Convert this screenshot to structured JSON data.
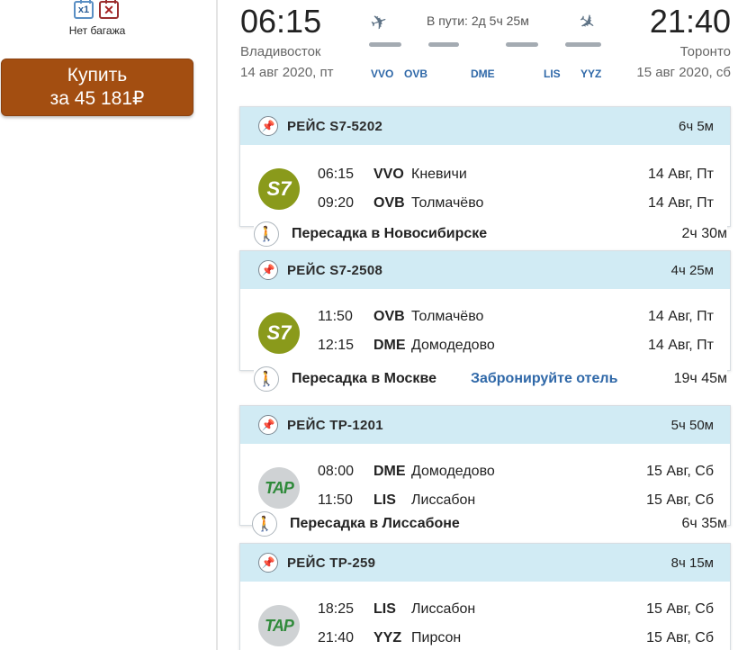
{
  "baggage": {
    "cabin_label": "x1",
    "no_bag_mark": "✕",
    "label": "Нет багажа"
  },
  "buy_button": {
    "line1": "Купить",
    "line2": "за 45 181₽"
  },
  "summary": {
    "departure_time": "06:15",
    "arrival_time": "21:40",
    "departure_city": "Владивосток",
    "arrival_city": "Торонто",
    "departure_date": "14 авг 2020, пт",
    "arrival_date": "15 авг 2020, сб",
    "travel_time": "В пути: 2д 5ч 25м",
    "codes": [
      "VVO",
      "OVB",
      "DME",
      "LIS",
      "YYZ"
    ]
  },
  "flights": [
    {
      "number": "РЕЙС S7-5202",
      "duration": "6ч 5м",
      "airline": "S7",
      "dep": {
        "time": "06:15",
        "code": "VVO",
        "name": "Кневичи",
        "date": "14 Авг, Пт"
      },
      "arr": {
        "time": "09:20",
        "code": "OVB",
        "name": "Толмачёво",
        "date": "14 Авг, Пт"
      }
    },
    {
      "number": "РЕЙС S7-2508",
      "duration": "4ч 25м",
      "airline": "S7",
      "dep": {
        "time": "11:50",
        "code": "OVB",
        "name": "Толмачёво",
        "date": "14 Авг, Пт"
      },
      "arr": {
        "time": "12:15",
        "code": "DME",
        "name": "Домодедово",
        "date": "14 Авг, Пт"
      }
    },
    {
      "number": "РЕЙС TP-1201",
      "duration": "5ч 50м",
      "airline": "TAP",
      "dep": {
        "time": "08:00",
        "code": "DME",
        "name": "Домодедово",
        "date": "15 Авг, Сб"
      },
      "arr": {
        "time": "11:50",
        "code": "LIS",
        "name": "Лиссабон",
        "date": "15 Авг, Сб"
      }
    },
    {
      "number": "РЕЙС TP-259",
      "duration": "8ч 15м",
      "airline": "TAP",
      "dep": {
        "time": "18:25",
        "code": "LIS",
        "name": "Лиссабон",
        "date": "15 Авг, Сб"
      },
      "arr": {
        "time": "21:40",
        "code": "YYZ",
        "name": "Пирсон",
        "date": "15 Авг, Сб"
      }
    }
  ],
  "transfers": [
    {
      "label": "Пересадка в Новосибирске",
      "duration": "2ч 30м"
    },
    {
      "label": "Пересадка в Москве",
      "hotel_link": "Забронируйте отель",
      "duration": "19ч 45м"
    },
    {
      "label": "Пересадка в Лиссабоне",
      "duration": "6ч 35м"
    }
  ],
  "colors": {
    "buy_button": "#a34e11",
    "card_header": "#d1ebf4",
    "link": "#2f68a8",
    "s7_logo": "#8a9a1b"
  }
}
